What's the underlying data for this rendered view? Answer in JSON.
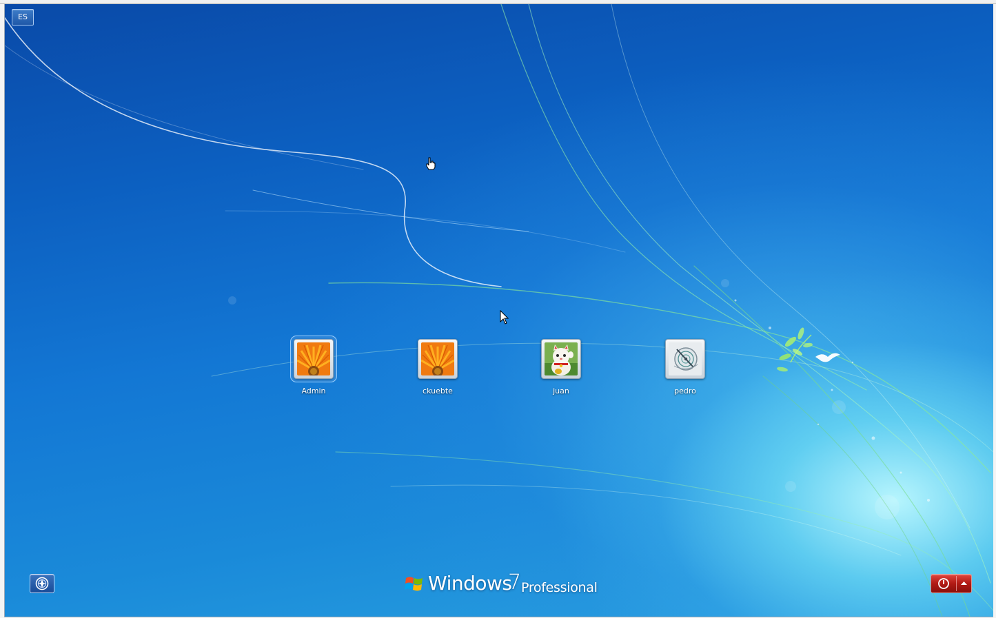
{
  "language_indicator": {
    "label": "ES"
  },
  "users": [
    {
      "name": "Admin",
      "picture": "orange-flower",
      "selected": true
    },
    {
      "name": "ckuebte",
      "picture": "orange-flower",
      "selected": false
    },
    {
      "name": "juan",
      "picture": "lucky-cat",
      "selected": false
    },
    {
      "name": "pedro",
      "picture": "compass-disc",
      "selected": false
    }
  ],
  "branding": {
    "product": "Windows",
    "version": "7",
    "edition": "Professional"
  },
  "buttons": {
    "ease_of_access_icon": "ease-of-access-icon",
    "shutdown_icon": "power-icon",
    "shutdown_options_icon": "caret-up-icon"
  },
  "colors": {
    "accent_red": "#b01a14",
    "background_blue": "#1377d4"
  }
}
